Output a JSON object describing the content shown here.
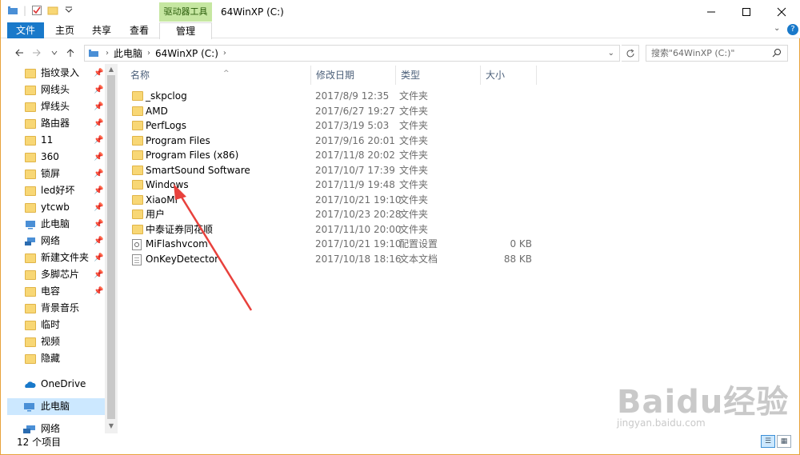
{
  "window": {
    "title": "64WinXP  (C:)",
    "context_tab": "驱动器工具"
  },
  "ribbon": {
    "tabs": [
      {
        "label": "文件"
      },
      {
        "label": "主页"
      },
      {
        "label": "共享"
      },
      {
        "label": "查看"
      },
      {
        "label": "管理"
      }
    ]
  },
  "address": {
    "segments": [
      "此电脑",
      "64WinXP  (C:)"
    ],
    "search_placeholder": "搜索\"64WinXP  (C:)\""
  },
  "sidebar": {
    "quick_access": [
      {
        "label": "指纹录入",
        "icon": "folder-icon"
      },
      {
        "label": "网线头",
        "icon": "folder-icon"
      },
      {
        "label": "焊线头",
        "icon": "folder-icon"
      },
      {
        "label": "路由器",
        "icon": "folder-icon"
      },
      {
        "label": "11",
        "icon": "folder-icon"
      },
      {
        "label": "360",
        "icon": "folder-icon"
      },
      {
        "label": "锁屏",
        "icon": "folder-icon"
      },
      {
        "label": "led好坏",
        "icon": "folder-icon"
      },
      {
        "label": "ytcwb",
        "icon": "folder-icon"
      },
      {
        "label": "此电脑",
        "icon": "computer-icon"
      },
      {
        "label": "网络",
        "icon": "network-icon"
      },
      {
        "label": "新建文件夹",
        "icon": "folder-icon"
      },
      {
        "label": "多脚芯片",
        "icon": "folder-icon"
      },
      {
        "label": "电容",
        "icon": "folder-icon"
      },
      {
        "label": "背景音乐",
        "icon": "folder-icon"
      },
      {
        "label": "临时",
        "icon": "folder-icon"
      },
      {
        "label": "视频",
        "icon": "folder-icon"
      },
      {
        "label": "隐藏",
        "icon": "folder-icon"
      }
    ],
    "onedrive": "OneDrive",
    "this_pc": "此电脑",
    "network": "网络"
  },
  "columns": {
    "name": "名称",
    "date": "修改日期",
    "type": "类型",
    "size": "大小"
  },
  "files": [
    {
      "name": "_skpclog",
      "date": "2017/8/9 12:35",
      "type": "文件夹",
      "size": "",
      "icon": "folder-icon"
    },
    {
      "name": "AMD",
      "date": "2017/6/27 19:27",
      "type": "文件夹",
      "size": "",
      "icon": "folder-icon"
    },
    {
      "name": "PerfLogs",
      "date": "2017/3/19 5:03",
      "type": "文件夹",
      "size": "",
      "icon": "folder-icon"
    },
    {
      "name": "Program Files",
      "date": "2017/9/16 20:01",
      "type": "文件夹",
      "size": "",
      "icon": "folder-icon"
    },
    {
      "name": "Program Files (x86)",
      "date": "2017/11/8 20:02",
      "type": "文件夹",
      "size": "",
      "icon": "folder-icon"
    },
    {
      "name": "SmartSound Software",
      "date": "2017/10/7 17:39",
      "type": "文件夹",
      "size": "",
      "icon": "folder-icon"
    },
    {
      "name": "Windows",
      "date": "2017/11/9 19:48",
      "type": "文件夹",
      "size": "",
      "icon": "folder-icon"
    },
    {
      "name": "XiaoMi",
      "date": "2017/10/21 19:10",
      "type": "文件夹",
      "size": "",
      "icon": "folder-icon"
    },
    {
      "name": "用户",
      "date": "2017/10/23 20:28",
      "type": "文件夹",
      "size": "",
      "icon": "folder-icon"
    },
    {
      "name": "中泰证券同花顺",
      "date": "2017/11/10 20:00",
      "type": "文件夹",
      "size": "",
      "icon": "folder-icon"
    },
    {
      "name": "MiFlashvcom",
      "date": "2017/10/21 19:10",
      "type": "配置设置",
      "size": "0 KB",
      "icon": "config-file-icon"
    },
    {
      "name": "OnKeyDetector",
      "date": "2017/10/18 18:16",
      "type": "文本文档",
      "size": "88 KB",
      "icon": "text-file-icon"
    }
  ],
  "status": {
    "item_count": "12 个项目"
  },
  "watermark": {
    "brand": "Baidu经验",
    "url": "jingyan.baidu.com"
  },
  "colors": {
    "accent": "#1979ca",
    "context_tab_bg": "#c6e7a1",
    "annotation_arrow": "#e8413c",
    "window_border": "#e8a33c"
  }
}
